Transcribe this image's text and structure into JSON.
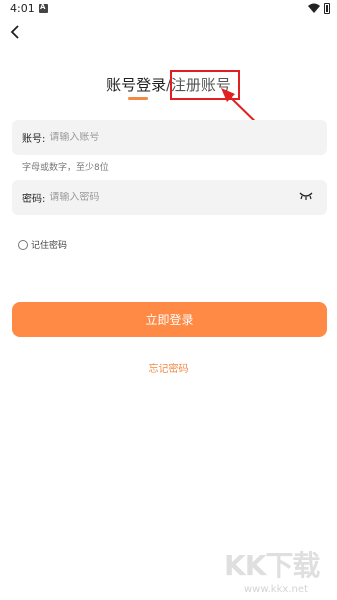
{
  "status_bar": {
    "time": "4:01",
    "notification_icon": "A"
  },
  "tabs": {
    "login_label": "账号登录",
    "separator": "/",
    "register_label": "注册账号"
  },
  "account": {
    "label": "账号:",
    "placeholder": "请输入账号",
    "hint": "字母或数字，至少8位"
  },
  "password": {
    "label": "密码:",
    "placeholder": "请输入密码"
  },
  "remember": {
    "label": "记住密码"
  },
  "login_button": {
    "label": "立即登录"
  },
  "forgot": {
    "label": "忘记密码"
  },
  "watermark": {
    "logo": "KK下载",
    "url": "www.kkx.net"
  },
  "colors": {
    "accent": "#ff8a45",
    "annotation": "#e02020",
    "field_bg": "#f3f3f3"
  }
}
